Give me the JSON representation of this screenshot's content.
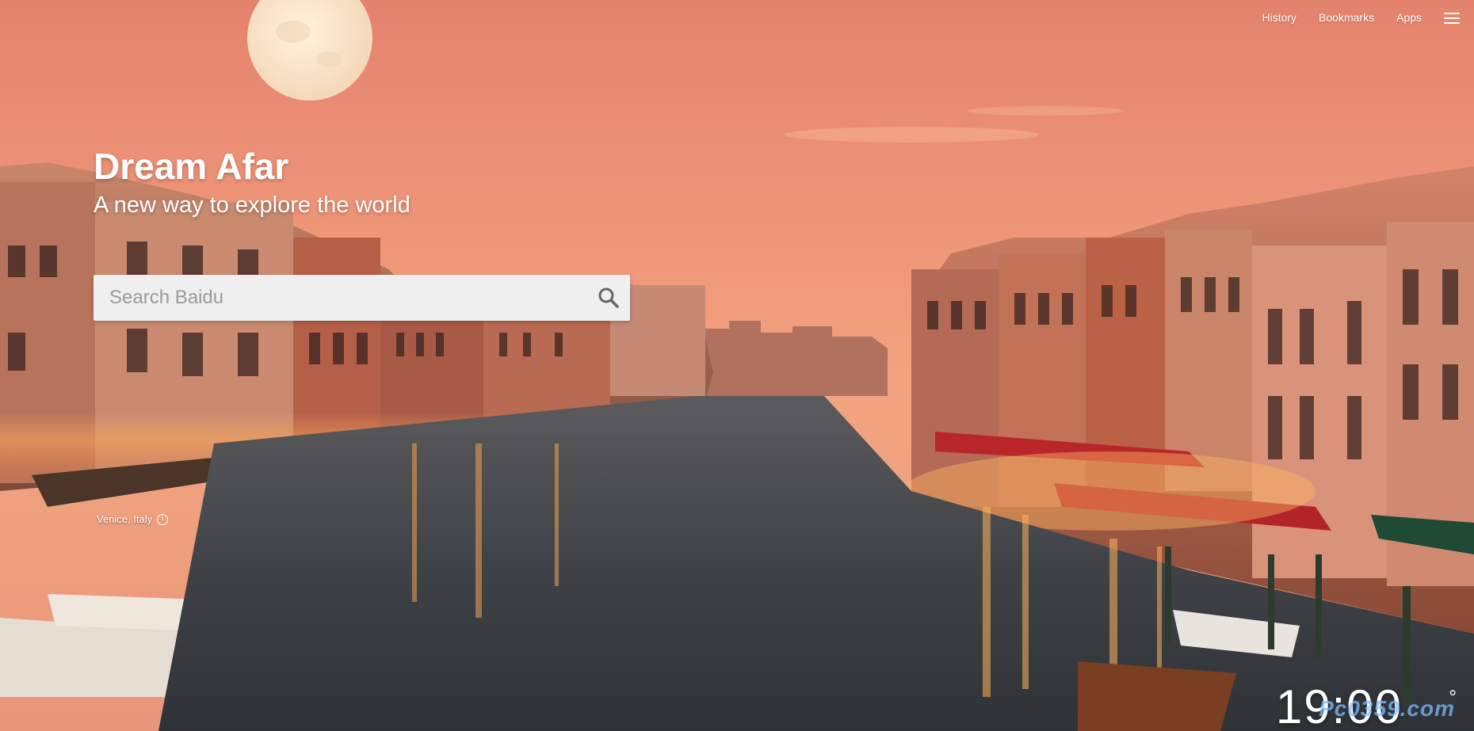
{
  "nav": {
    "history": "History",
    "bookmarks": "Bookmarks",
    "apps": "Apps",
    "menu_icon": "hamburger-menu-icon"
  },
  "hero": {
    "title": "Dream Afar",
    "subtitle": "A new way to explore the world"
  },
  "search": {
    "placeholder": "Search Baidu",
    "value": "",
    "icon": "search-icon"
  },
  "location": {
    "label": "Venice, Italy",
    "icon": "info-icon"
  },
  "clock": {
    "time": "19:00",
    "temp_unit": "°"
  },
  "watermark": {
    "text": "Pc0359.com"
  },
  "colors": {
    "sky_top": "#e88b6f",
    "sky_mid": "#f3a27d",
    "water": "#4b5058",
    "text": "#ffffff",
    "search_bg": "#efefef"
  }
}
